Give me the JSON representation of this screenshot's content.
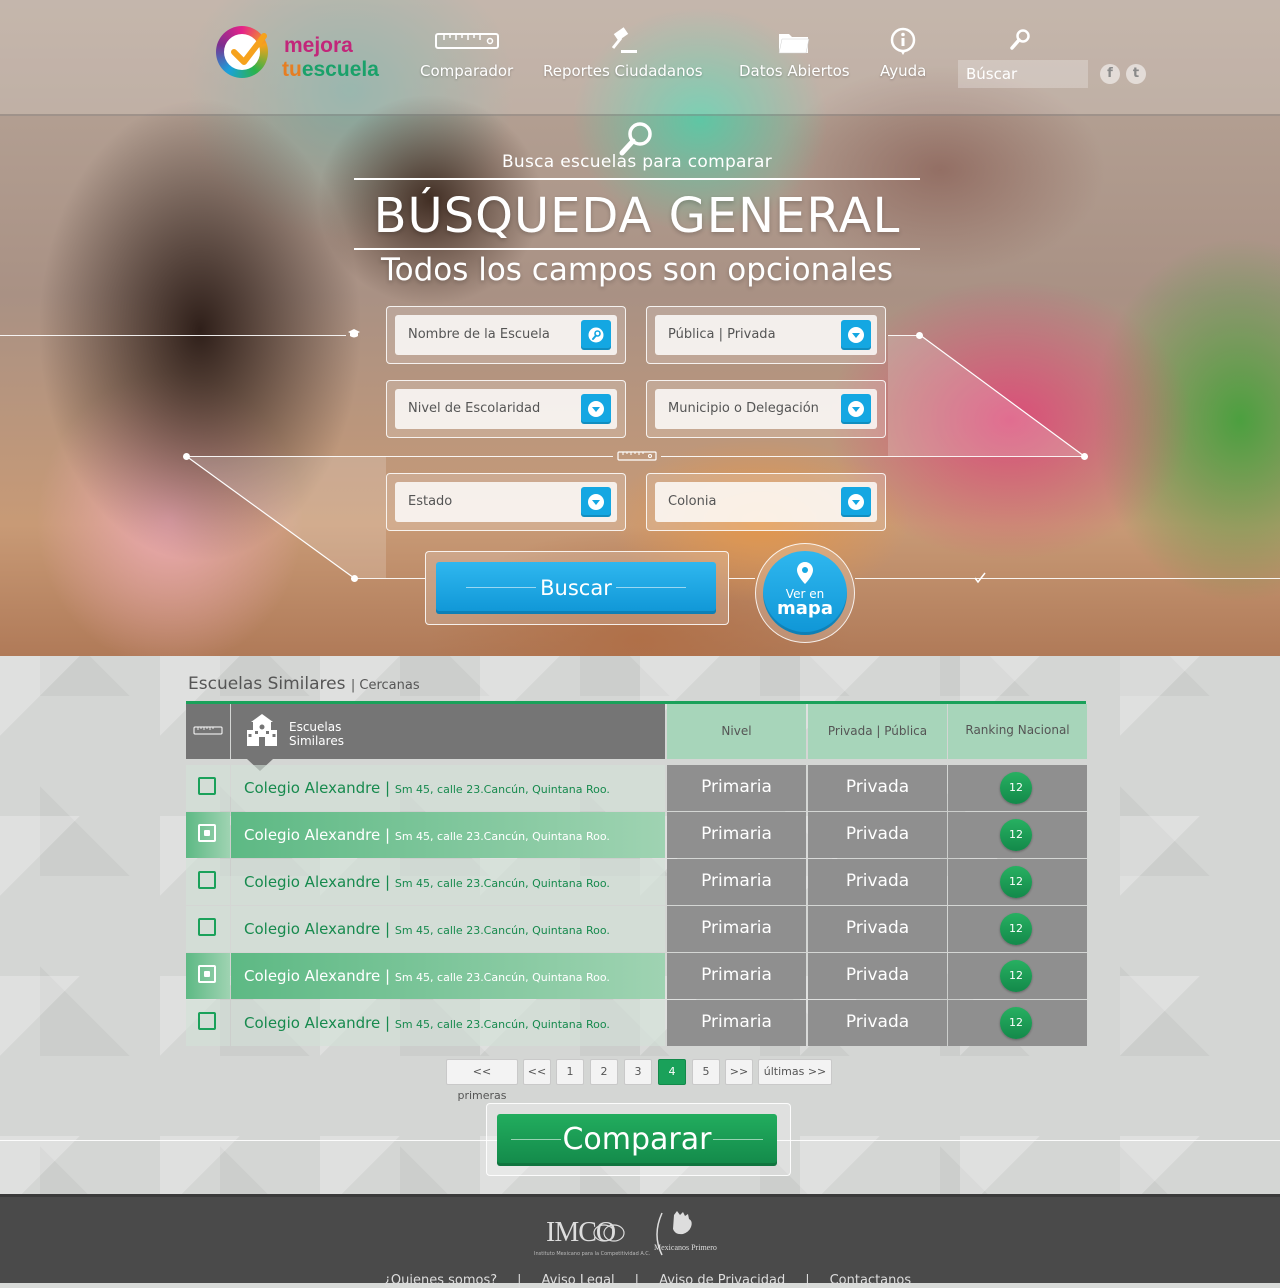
{
  "brand": {
    "line1": "mejora",
    "line2_a": "tu",
    "line2_b": "escuela"
  },
  "nav": {
    "items": [
      {
        "label": "Comparador",
        "icon": "ruler-icon"
      },
      {
        "label": "Reportes Ciudadanos",
        "icon": "gavel-icon"
      },
      {
        "label": "Datos Abiertos",
        "icon": "folder-icon"
      },
      {
        "label": "Ayuda",
        "icon": "info-icon"
      }
    ],
    "search_placeholder": "Búscar",
    "social": {
      "facebook": "f",
      "twitter": "t"
    }
  },
  "hero": {
    "subtitle": "Busca escuelas para comparar",
    "title": "BÚSQUEDA GENERAL",
    "note": "Todos los campos son opcionales",
    "fields": {
      "school_name": "Nombre de la Escuela",
      "type": "Pública | Privada",
      "level": "Nivel de Escolaridad",
      "municipality": "Municipio o Delegación",
      "state": "Estado",
      "neighborhood": "Colonia"
    },
    "search_button": "Buscar",
    "map_button": {
      "line1": "Ver en",
      "line2": "mapa"
    }
  },
  "results": {
    "title": "Escuelas Similares",
    "subtitle": "| Cercanas",
    "header": {
      "name": {
        "line1": "Escuelas",
        "line2": "Similares"
      },
      "level": "Nivel",
      "type": "Privada | Pública",
      "ranking": "Ranking Nacional"
    },
    "rows": [
      {
        "name": "Colegio Alexandre |",
        "address": "Sm 45, calle 23.Cancún, Quintana Roo.",
        "level": "Primaria",
        "type": "Privada",
        "rank": "12",
        "selected": false
      },
      {
        "name": "Colegio Alexandre |",
        "address": "Sm 45, calle 23.Cancún, Quintana Roo.",
        "level": "Primaria",
        "type": "Privada",
        "rank": "12",
        "selected": true
      },
      {
        "name": "Colegio Alexandre |",
        "address": "Sm 45, calle 23.Cancún, Quintana Roo.",
        "level": "Primaria",
        "type": "Privada",
        "rank": "12",
        "selected": false
      },
      {
        "name": "Colegio Alexandre |",
        "address": "Sm 45, calle 23.Cancún, Quintana Roo.",
        "level": "Primaria",
        "type": "Privada",
        "rank": "12",
        "selected": false
      },
      {
        "name": "Colegio Alexandre |",
        "address": "Sm 45, calle 23.Cancún, Quintana Roo.",
        "level": "Primaria",
        "type": "Privada",
        "rank": "12",
        "selected": true
      },
      {
        "name": "Colegio Alexandre |",
        "address": "Sm 45, calle 23.Cancún, Quintana Roo.",
        "level": "Primaria",
        "type": "Privada",
        "rank": "12",
        "selected": false
      }
    ],
    "pagination": {
      "first": "<< primeras",
      "prev": "<<",
      "pages": [
        "1",
        "2",
        "3",
        "4",
        "5"
      ],
      "current": "4",
      "next": ">>",
      "last": "últimas >>"
    },
    "compare_button": "Comparar"
  },
  "footer": {
    "imco": {
      "logo": "IMCO",
      "caption": "Instituto Mexicano para la Competitividad A.C."
    },
    "mexicanos": {
      "logo": "Mexicanos Primero"
    },
    "links": [
      "¿Quienes somos?",
      "Aviso Legal",
      "Aviso de Privacidad",
      "Contactanos"
    ]
  },
  "colors": {
    "accent_blue": "#14a7e2",
    "accent_green": "#1aa15a",
    "table_grey": "#8f8f8f"
  }
}
